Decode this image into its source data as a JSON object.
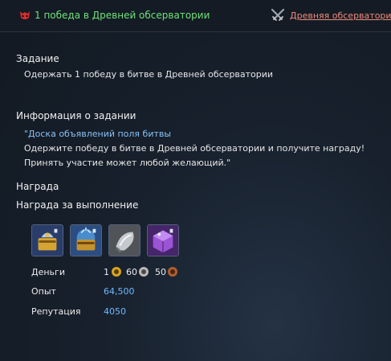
{
  "header": {
    "quest_title": "1 победа в Древней обсерватории",
    "location_link": "Древняя обсерватория",
    "quest_type_icon": "mask-icon",
    "location_icon": "crossed-swords-icon",
    "title_color": "#6fe07a",
    "link_color": "#ef8a7d"
  },
  "task": {
    "title": "Задание",
    "text": "Одержать 1 победу в битве в Древней обсерватории"
  },
  "info": {
    "title": "Информация о задании",
    "link_text": "\"Доска объявлений поля битвы",
    "line2": "Одержите победу в битве в Древней обсерватории и получите награду!",
    "line3": "Принять участие может любой желающий.\""
  },
  "reward": {
    "title": "Награда",
    "subtitle": "Награда за выполнение",
    "items": [
      {
        "name": "reward-item-gold-helmet-crate",
        "icon": "armored-crate-icon"
      },
      {
        "name": "reward-item-blue-crate",
        "icon": "shining-crate-icon"
      },
      {
        "name": "reward-item-metal-shard",
        "icon": "metal-shard-icon"
      },
      {
        "name": "reward-item-purple-cube",
        "icon": "purple-cube-icon"
      }
    ],
    "money": {
      "label": "Деньги",
      "gold": "1",
      "silver": "60",
      "copper": "50"
    },
    "exp": {
      "label": "Опыт",
      "value": "64,500"
    },
    "reputation": {
      "label": "Репутация",
      "value": "4050"
    }
  }
}
